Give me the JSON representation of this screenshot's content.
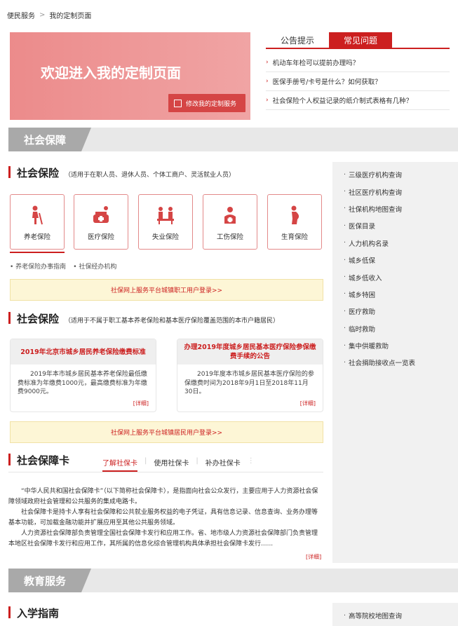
{
  "breadcrumb": {
    "home": "便民服务",
    "sep": ">",
    "current": "我的定制页面"
  },
  "banner": {
    "title": "欢迎进入我的定制页面",
    "edit_button": "修改我的定制服务"
  },
  "notice_tabs": [
    {
      "label": "公告提示",
      "active": false
    },
    {
      "label": "常见问题",
      "active": true
    }
  ],
  "faq": [
    "机动车年检可以提前办理吗？",
    "医保手册号/卡号是什么？如何获取？",
    "社会保险个人权益记录的纸介制式表格有几种？"
  ],
  "section1": {
    "title": "社会保障"
  },
  "social1": {
    "title": "社会保险",
    "note": "（适用于在职人员、退休人员、个体工商户、灵活就业人员）",
    "cards": [
      {
        "label": "养老保险",
        "icon": "elderly-icon"
      },
      {
        "label": "医疗保险",
        "icon": "medicine-icon"
      },
      {
        "label": "失业保险",
        "icon": "unemployment-icon"
      },
      {
        "label": "工伤保险",
        "icon": "injury-icon"
      },
      {
        "label": "生育保险",
        "icon": "maternity-icon"
      }
    ],
    "links": [
      "养老保险办事指南",
      "社保经办机构"
    ],
    "login_bar": "社保网上服务平台城镇职工用户登录>>"
  },
  "social2": {
    "title": "社会保险",
    "note": "（适用于不属于职工基本养老保险和基本医疗保险覆盖范围的本市户籍居民）",
    "news": [
      {
        "title": "2019年北京市城乡居民养老保险缴费标准",
        "body": "2019年本市城乡居民基本养老保险最低缴费标准为年缴费1000元，最高缴费标准为年缴费9000元。",
        "more": "[详细]"
      },
      {
        "title": "办理2019年度城乡居民基本医疗保险参保缴费手续的公告",
        "body": "2019年度本市城乡居民基本医疗保险的参保缴费时间为2018年9月1日至2018年11月30日。",
        "more": "[详细]"
      }
    ],
    "login_bar": "社保网上服务平台城镇居民用户登录>>"
  },
  "card_section": {
    "title": "社会保障卡",
    "tabs": [
      "了解社保卡",
      "使用社保卡",
      "补办社保卡"
    ],
    "paragraphs": [
      "“中华人民共和国社会保障卡”（以下简称社会保障卡），是指面向社会公众发行，主要应用于人力资源社会保障领域政府社会管理和公共服务的集成电路卡。",
      "社会保障卡是持卡人享有社会保障和公共就业服务权益的电子凭证，具有信息记录、信息查询、业务办理等基本功能，可加载金融功能并扩展应用至其他公共服务领域。",
      "人力资源社会保障部负责管理全国社会保障卡发行和应用工作。省、地市级人力资源社会保障部门负责管理本地区社会保障卡发行和应用工作，其所属的信息化综合管理机构具体承担社会保障卡发行......"
    ],
    "more": "[详细]"
  },
  "sidebar": [
    "三级医疗机构查询",
    "社区医疗机构查询",
    "社保机构地图查询",
    "医保目录",
    "人力机构名录",
    "城乡低保",
    "城乡低收入",
    "城乡特困",
    "医疗救助",
    "临时救助",
    "集中供暖救助",
    "社会捐助接收点一览表"
  ],
  "section2": {
    "title": "教育服务"
  },
  "edu": {
    "title": "入学指南"
  },
  "sidebar2": [
    "高等院校地图查询"
  ],
  "colors": {
    "accent": "#cc1f1f",
    "banner": "#ec8b8b",
    "section": "#a9a9a9"
  }
}
